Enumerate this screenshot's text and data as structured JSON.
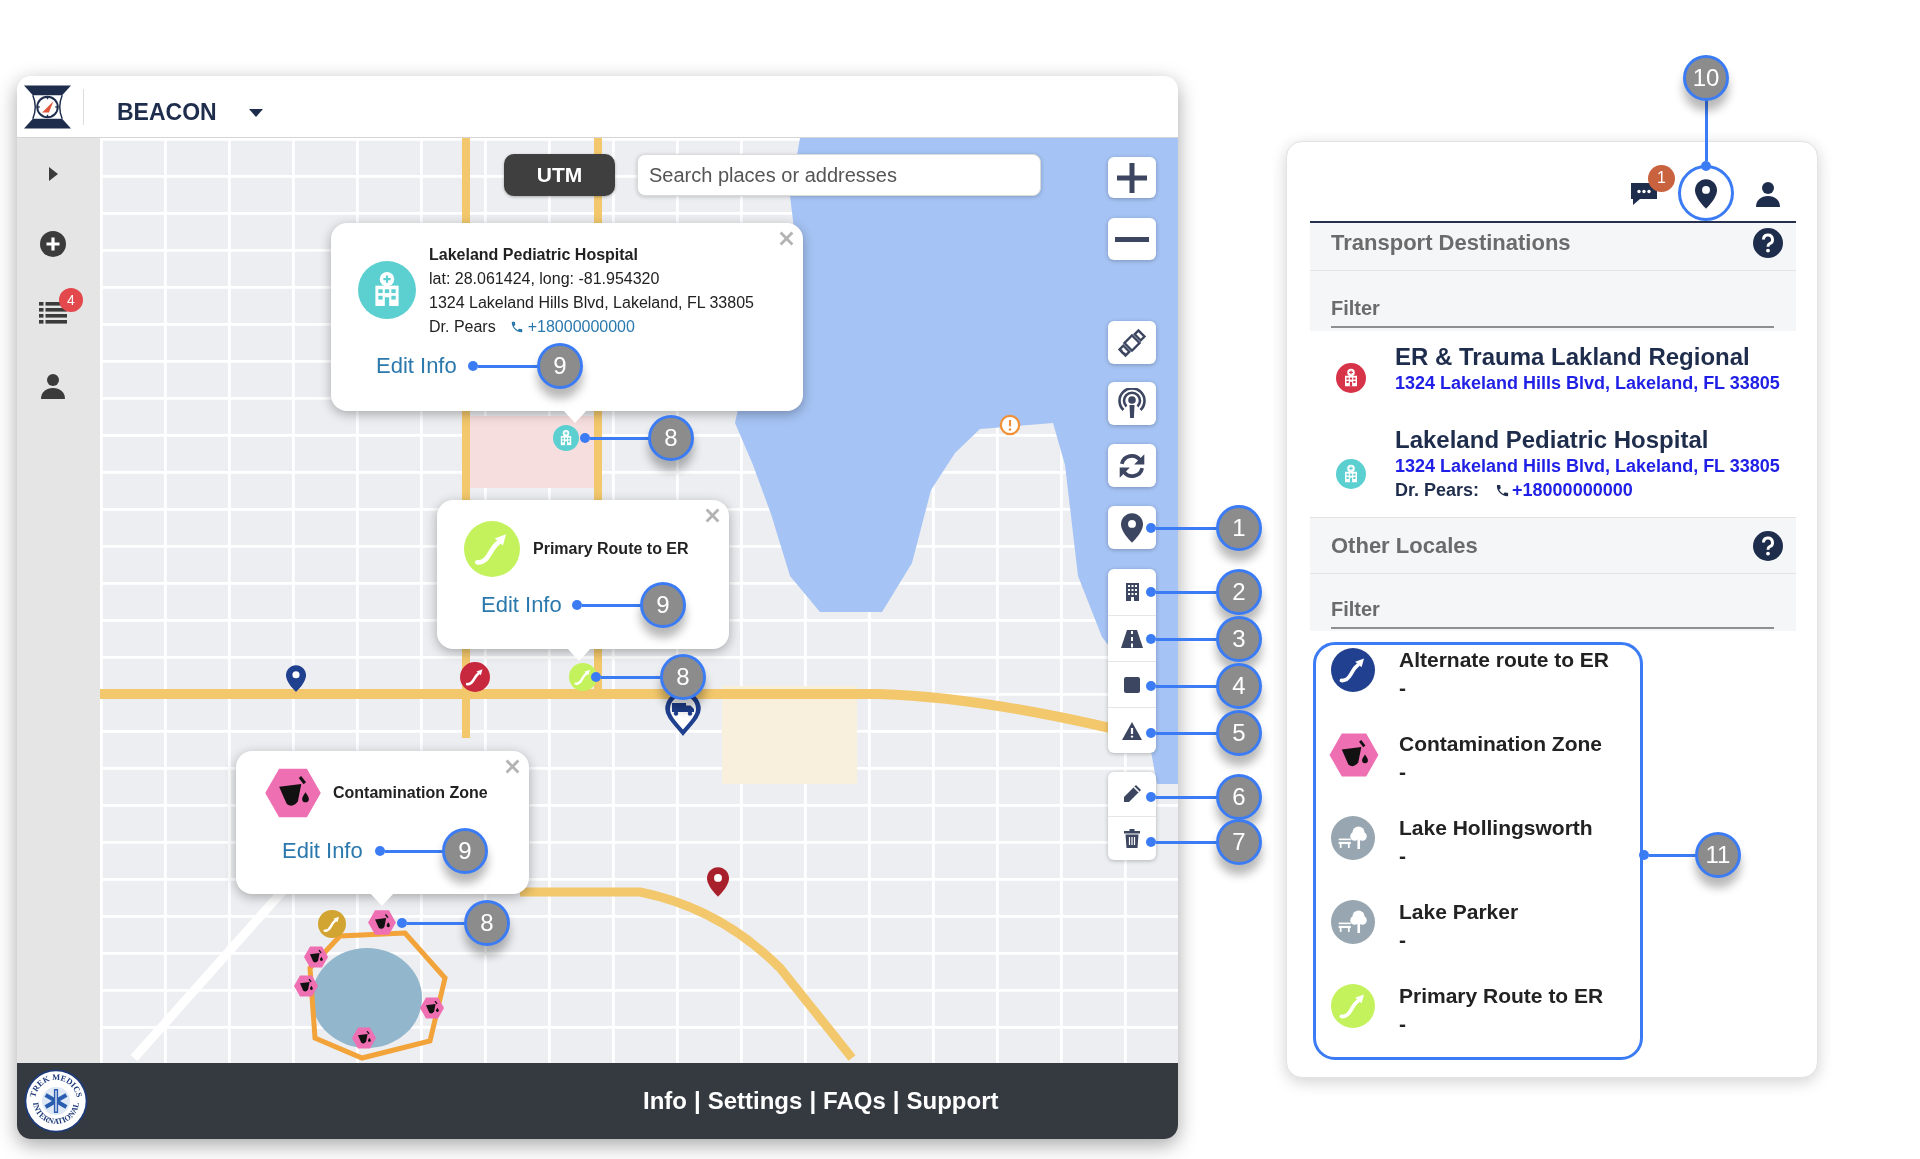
{
  "header": {
    "brand": "BEACON"
  },
  "sidebar": {
    "list_badge": "4"
  },
  "map": {
    "utm_button": "UTM",
    "search": {
      "placeholder": "Search places or addresses"
    },
    "toolbar_callouts": [
      "1",
      "2",
      "3",
      "4",
      "5",
      "6",
      "7"
    ],
    "markers": [
      {
        "kind": "hospital",
        "color": "#5ccfd0",
        "callout": "8"
      },
      {
        "kind": "route",
        "color": "#c4f25c",
        "callout": "8"
      },
      {
        "kind": "zone",
        "color": "#ee6fb2",
        "callout": "8"
      },
      {
        "kind": "route",
        "color": "#c8283e"
      },
      {
        "kind": "pin",
        "color": "#1f3f8f"
      },
      {
        "kind": "pin",
        "color": "#a8202b"
      },
      {
        "kind": "truck",
        "color": "#1f3f8f"
      },
      {
        "kind": "route",
        "color": "#d2a431"
      },
      {
        "kind": "zone",
        "color": "#ee6fb2"
      },
      {
        "kind": "zone",
        "color": "#ee6fb2"
      },
      {
        "kind": "zone",
        "color": "#ee6fb2"
      },
      {
        "kind": "zone",
        "color": "#ee6fb2"
      },
      {
        "kind": "alert",
        "color": "#f0913a"
      }
    ],
    "popups": [
      {
        "kind": "facility",
        "color": "#5ccfd0",
        "title": "Lakeland Pediatric Hospital",
        "coordinates": "lat: 28.061424, long: -81.954320",
        "address": "1324 Lakeland Hills Blvd, Lakeland, FL 33805",
        "contact": "Dr. Pears",
        "phone": "+18000000000",
        "link": "Edit Info",
        "callout": "9"
      },
      {
        "kind": "route",
        "color": "#c4f25c",
        "title": "Primary Route to ER",
        "link": "Edit Info",
        "callout": "9"
      },
      {
        "kind": "zone",
        "color": "#ee6fb2",
        "title": "Contamination Zone",
        "link": "Edit Info",
        "callout": "9"
      }
    ]
  },
  "footer": {
    "logo_text": [
      "TREK MEDICS",
      "INTERNATIONAL"
    ],
    "links": [
      "Info",
      "Settings",
      "FAQs",
      "Support"
    ],
    "separators": [
      "|",
      "|",
      "|"
    ]
  },
  "panel": {
    "chat_badge": "1",
    "location_callout": "10",
    "sections": [
      {
        "title": "Transport Destinations",
        "filter": {
          "placeholder": "Filter"
        },
        "items": [
          {
            "kind": "hospital",
            "color": "#d7344a",
            "name": "ER & Trauma Lakland Regional",
            "address": "1324 Lakeland Hills Blvd, Lakeland, FL 33805"
          },
          {
            "kind": "hospital",
            "color": "#5ccfd0",
            "name": "Lakeland Pediatric Hospital",
            "address": "1324 Lakeland Hills Blvd, Lakeland, FL 33805",
            "contact": "Dr. Pears:",
            "phone": "+18000000000"
          }
        ]
      },
      {
        "title": "Other Locales",
        "filter": {
          "placeholder": "Filter"
        },
        "callout": "11",
        "items": [
          {
            "kind": "route",
            "color": "#21408f",
            "name": "Alternate route to ER",
            "detail": "-"
          },
          {
            "kind": "zone",
            "color": "#ee6fb2",
            "name": "Contamination Zone",
            "detail": "-"
          },
          {
            "kind": "park",
            "color": "#97a6b0",
            "name": "Lake Hollingsworth",
            "detail": "-"
          },
          {
            "kind": "park",
            "color": "#97a6b0",
            "name": "Lake Parker",
            "detail": "-"
          },
          {
            "kind": "route",
            "color": "#c4f25c",
            "name": "Primary Route to ER",
            "detail": "-"
          }
        ]
      }
    ]
  }
}
